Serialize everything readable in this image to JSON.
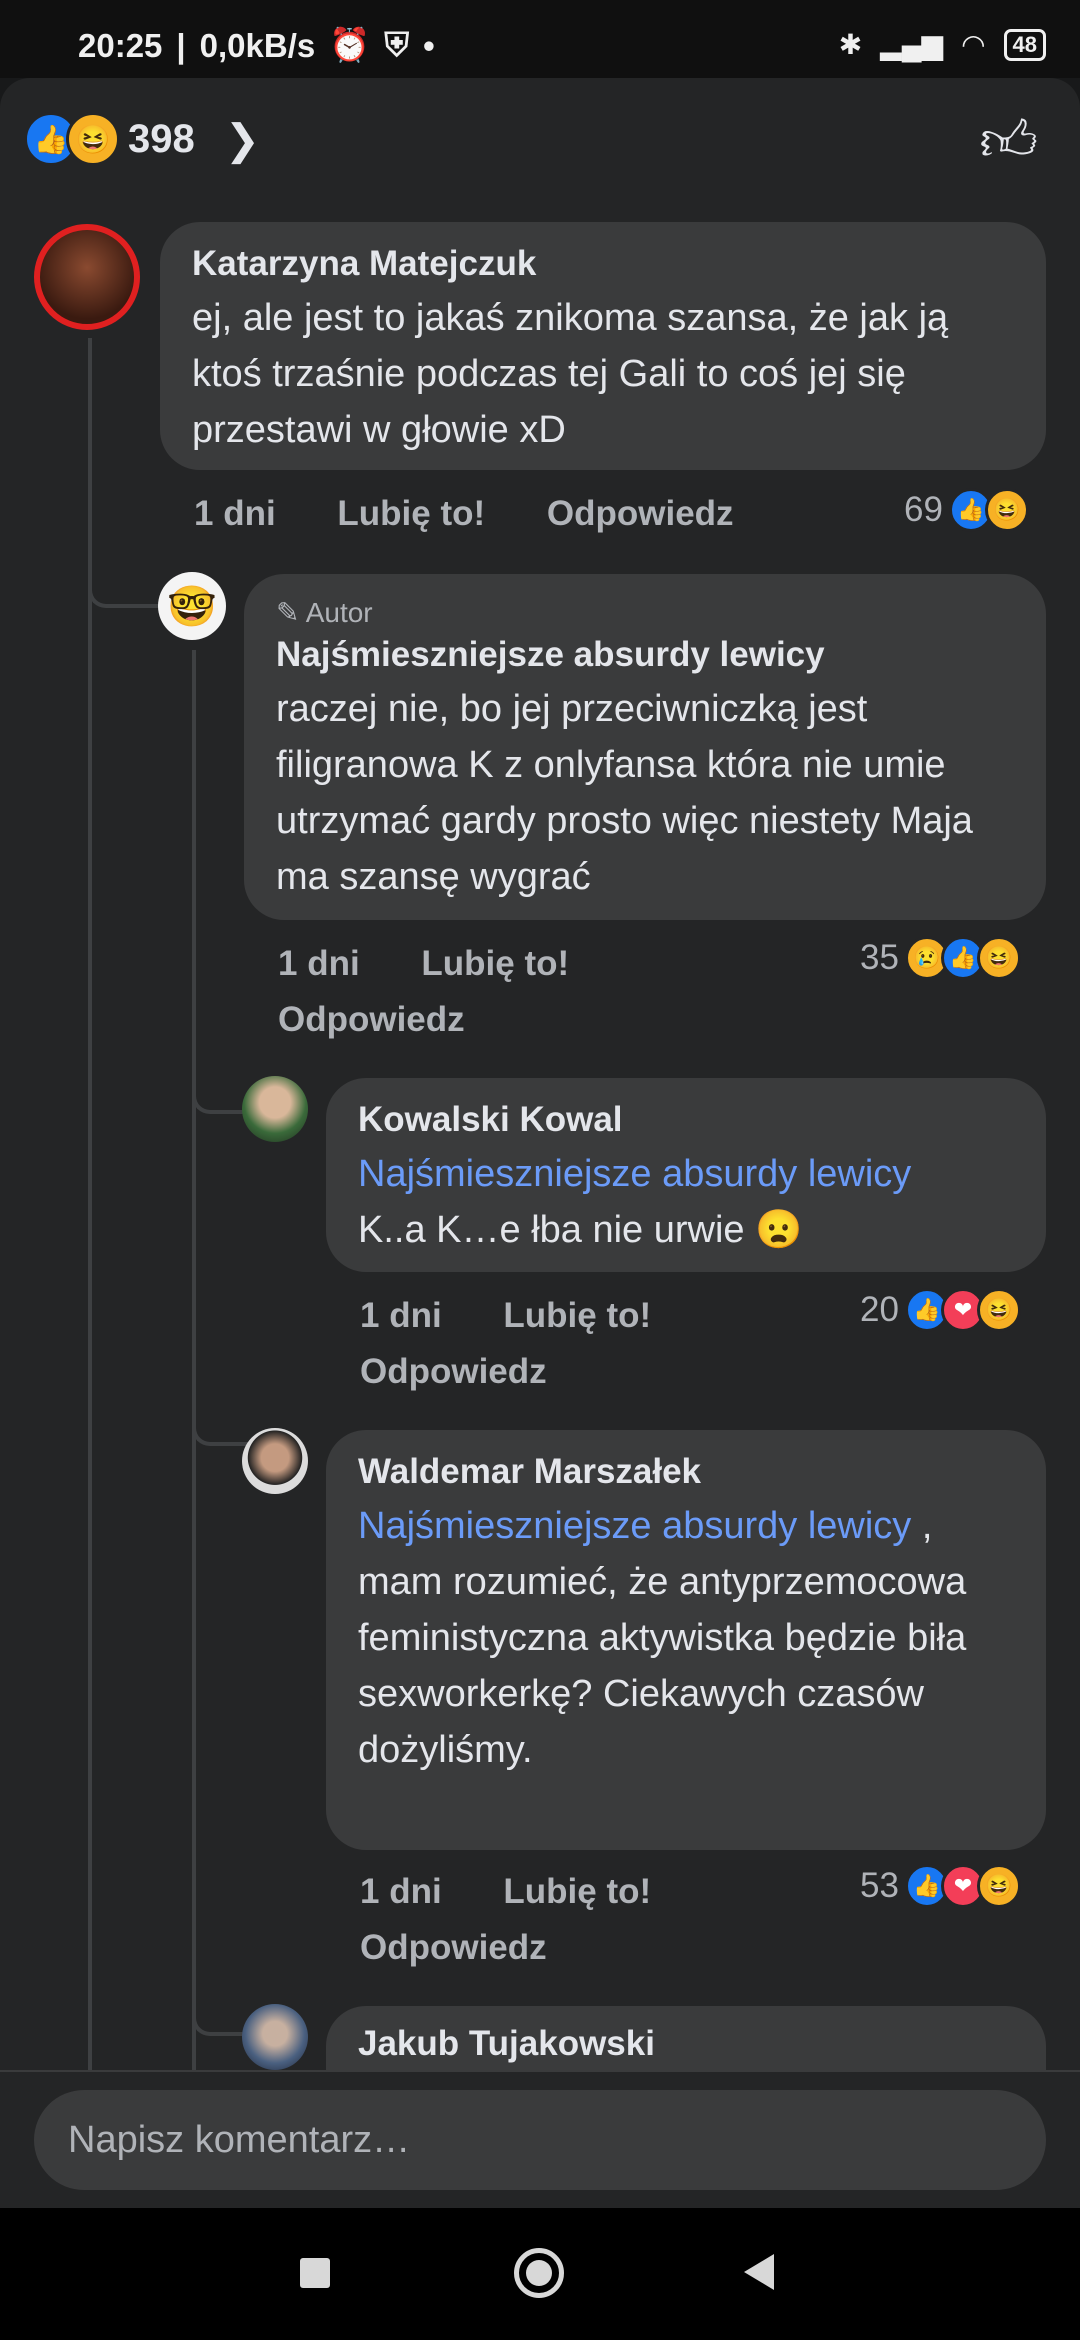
{
  "status": {
    "time": "20:25",
    "speed": "0,0kB/s",
    "battery": "48"
  },
  "header": {
    "reaction_count": "398"
  },
  "comments": [
    {
      "name": "Katarzyna Matejczuk",
      "text": "ej, ale jest to jakaś znikoma szansa, że jak ją ktoś trzaśnie podczas tej Gali to coś jej się przestawi w głowie xD",
      "time": "1 dni",
      "like": "Lubię to!",
      "reply": "Odpowiedz",
      "count": "69"
    },
    {
      "author_tag": "Autor",
      "name": "Najśmieszniejsze absurdy lewicy",
      "text": "raczej nie, bo jej przeciwniczką jest filigranowa K z onlyfansa która nie umie utrzymać gardy prosto więc niestety Maja ma szansę wygrać",
      "time": "1 dni",
      "like": "Lubię to!",
      "reply": "Odpowiedz",
      "count": "35"
    },
    {
      "name": "Kowalski Kowal",
      "mention": "Najśmieszniejsze absurdy lewicy",
      "text": "K..a K…e łba nie urwie 😦",
      "time": "1 dni",
      "like": "Lubię to!",
      "reply": "Odpowiedz",
      "count": "20"
    },
    {
      "name": "Waldemar Marszałek",
      "mention": "Najśmieszniejsze absurdy lewicy",
      "text": " , mam rozumieć, że antyprzemocowa feministyczna aktywistka będzie biła sexworkerkę? Ciekawych czasów dożyliśmy.",
      "time": "1 dni",
      "like": "Lubię to!",
      "reply": "Odpowiedz",
      "count": "53"
    },
    {
      "name": "Jakub Tujakowski"
    }
  ],
  "input": {
    "placeholder": "Napisz komentarz…"
  },
  "colors": {
    "like": "#1877f2",
    "love": "#f33e58",
    "haha": "#f7b125",
    "mention": "#6b9bf8"
  }
}
